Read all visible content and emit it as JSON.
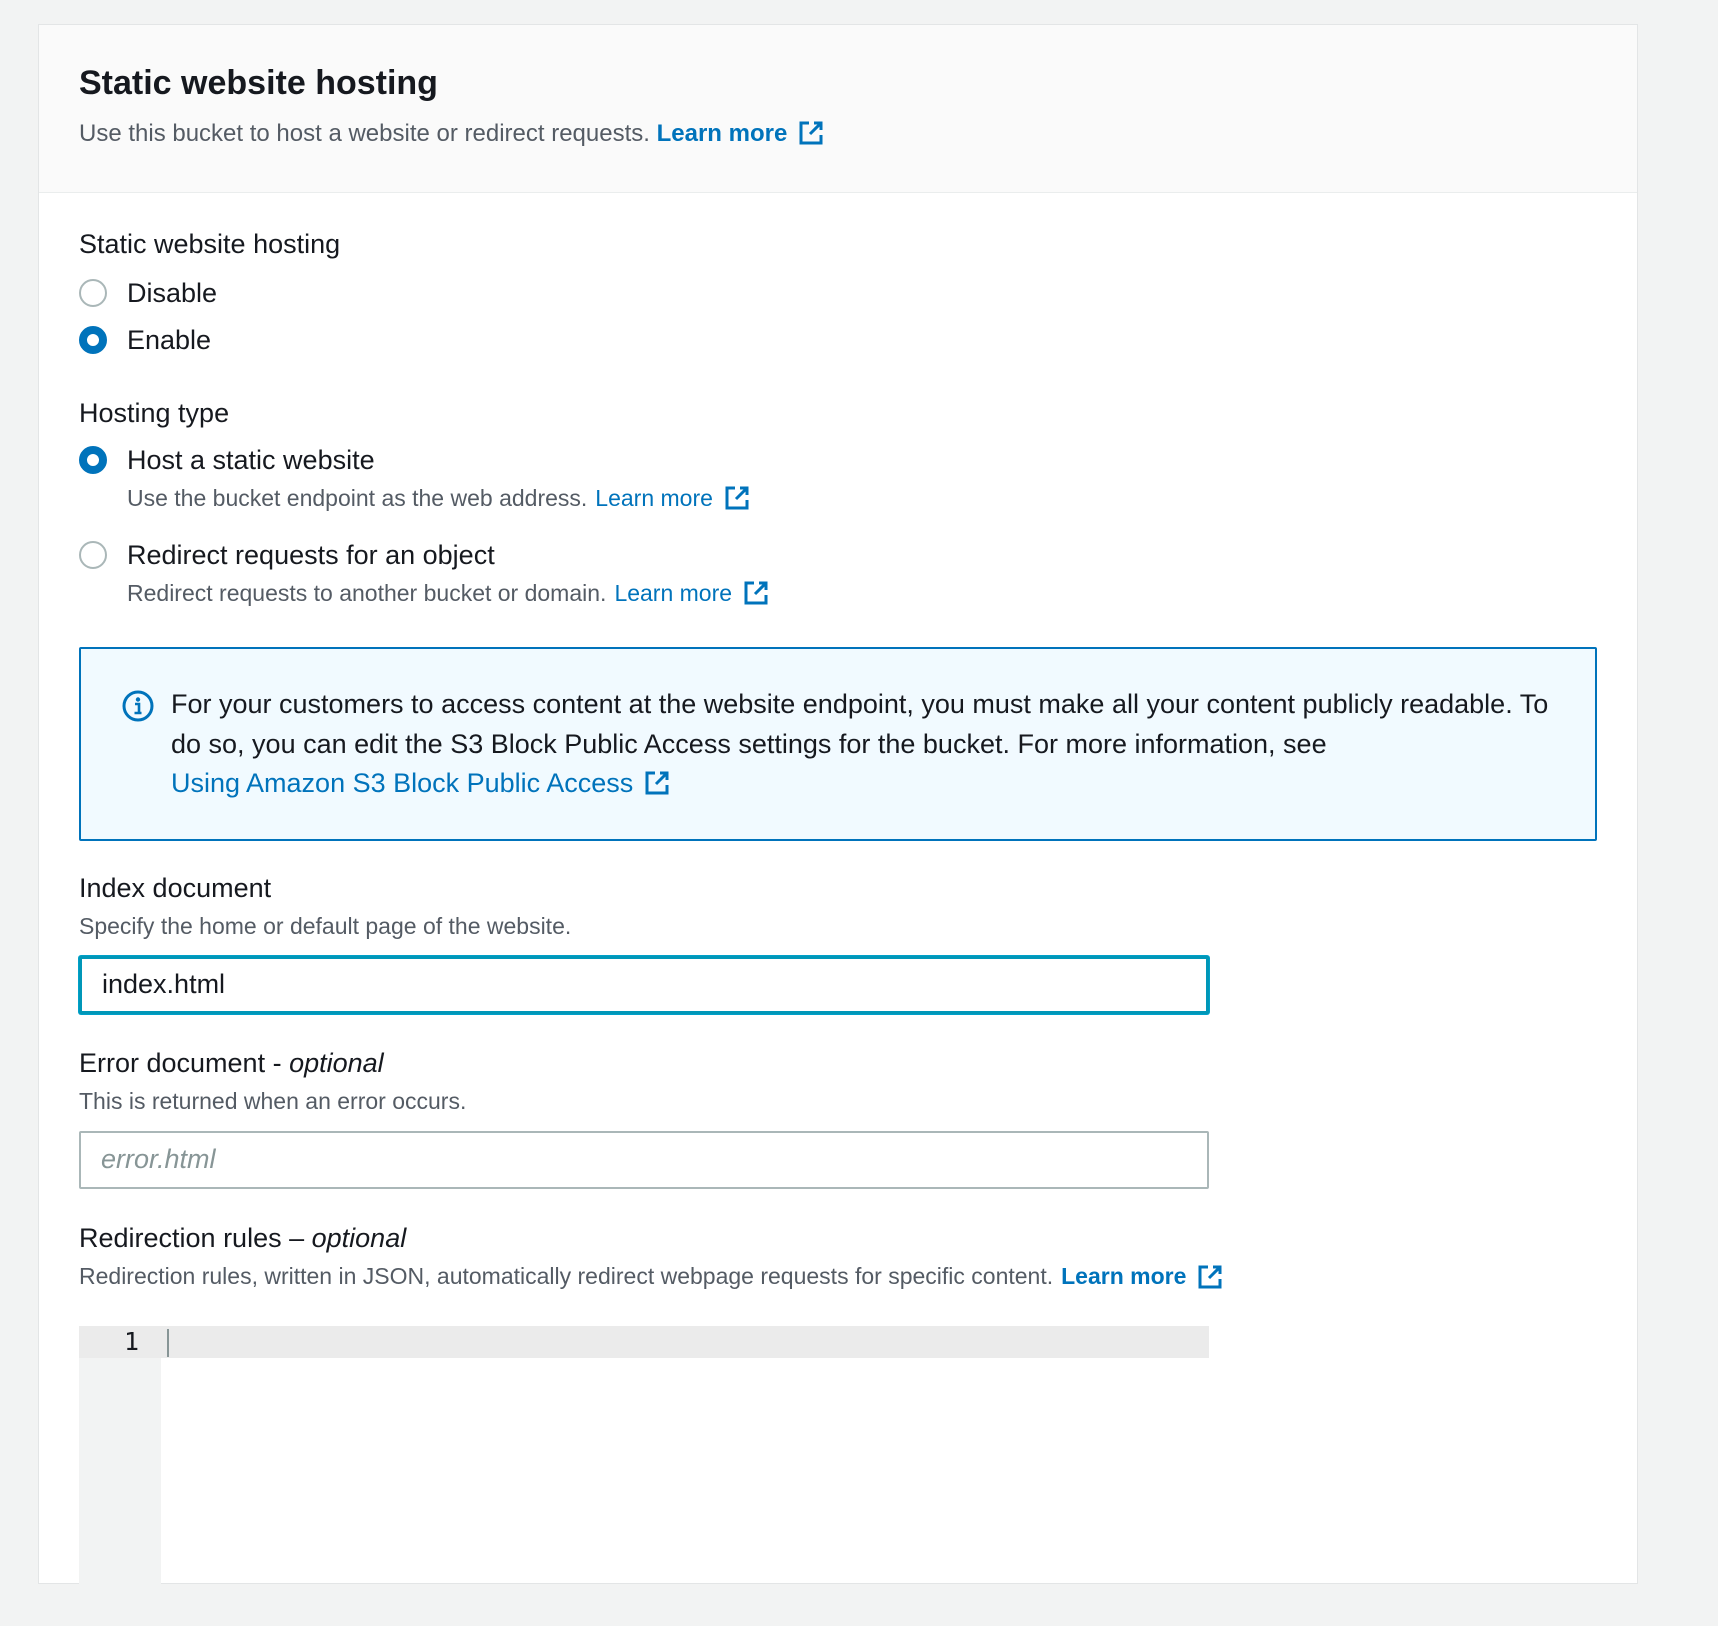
{
  "section": {
    "title": "Static website hosting",
    "description": "Use this bucket to host a website or redirect requests.",
    "learn_more": "Learn more"
  },
  "hosting_toggle": {
    "label": "Static website hosting",
    "options": [
      {
        "label": "Disable",
        "selected": false
      },
      {
        "label": "Enable",
        "selected": true
      }
    ]
  },
  "hosting_type": {
    "label": "Hosting type",
    "options": [
      {
        "label": "Host a static website",
        "description": "Use the bucket endpoint as the web address.",
        "link": "Learn more",
        "selected": true
      },
      {
        "label": "Redirect requests for an object",
        "description": "Redirect requests to another bucket or domain.",
        "link": "Learn more",
        "selected": false
      }
    ]
  },
  "info_alert": {
    "text": "For your customers to access content at the website endpoint, you must make all your content publicly readable. To do so, you can edit the S3 Block Public Access settings for the bucket. For more information, see",
    "link": "Using Amazon S3 Block Public Access"
  },
  "index_document": {
    "label": "Index document",
    "description": "Specify the home or default page of the website.",
    "value": "index.html"
  },
  "error_document": {
    "label": "Error document - ",
    "label_optional": "optional",
    "description": "This is returned when an error occurs.",
    "placeholder": "error.html"
  },
  "redirection_rules": {
    "label": "Redirection rules – ",
    "label_optional": "optional",
    "description": "Redirection rules, written in JSON, automatically redirect webpage requests for specific content.",
    "learn_more": "Learn more",
    "line_number": "1"
  },
  "colors": {
    "link": "#0073bb",
    "radio_checked": "#0073bb",
    "info_border": "#0073bb",
    "info_bg": "#f1faff",
    "focus": "#0097b8"
  },
  "icons": [
    "external-link-icon",
    "info-circle-icon"
  ]
}
